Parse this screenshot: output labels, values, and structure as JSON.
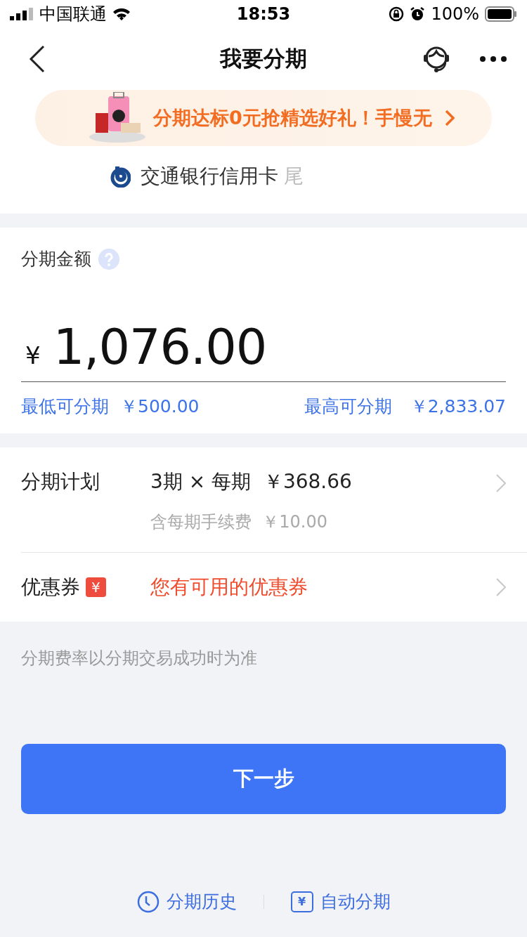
{
  "status_bar": {
    "carrier": "中国联通",
    "time": "18:53",
    "battery": "100%"
  },
  "nav": {
    "title": "我要分期"
  },
  "banner": {
    "text": "分期达标0元抢精选好礼！手慢无"
  },
  "card": {
    "name": "交通银行信用卡",
    "suffix": "尾"
  },
  "amount": {
    "label": "分期金额",
    "currency": "¥",
    "value": "1,076.00",
    "min_label": "最低可分期",
    "min_value": "￥500.00",
    "max_label": "最高可分期",
    "max_value": "￥2,833.07"
  },
  "plan": {
    "label": "分期计划",
    "summary": "3期 × 每期  ￥368.66",
    "fee": "含每期手续费  ￥10.00"
  },
  "coupon": {
    "label": "优惠券",
    "badge": "¥",
    "text": "您有可用的优惠券"
  },
  "note": "分期费率以分期交易成功时为准",
  "next_button": "下一步",
  "links": [
    {
      "kind": "history",
      "label": "分期历史"
    },
    {
      "kind": "auto",
      "label": "自动分期",
      "glyph": "¥"
    }
  ]
}
